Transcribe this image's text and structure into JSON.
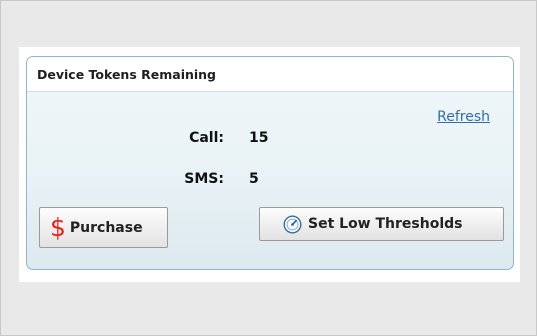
{
  "panel": {
    "title": "Device Tokens Remaining",
    "refresh_label": "Refresh",
    "stats": [
      {
        "label": "Call:",
        "value": "15"
      },
      {
        "label": "SMS:",
        "value": "5"
      }
    ],
    "purchase_button": {
      "icon": "dollar-icon",
      "label": "Purchase"
    },
    "threshold_button": {
      "icon": "gauge-icon",
      "label": "Set Low Thresholds"
    }
  },
  "colors": {
    "accent_link": "#2f6fa8",
    "dollar_icon": "#e2231a",
    "panel_border": "#8cb7c9"
  }
}
